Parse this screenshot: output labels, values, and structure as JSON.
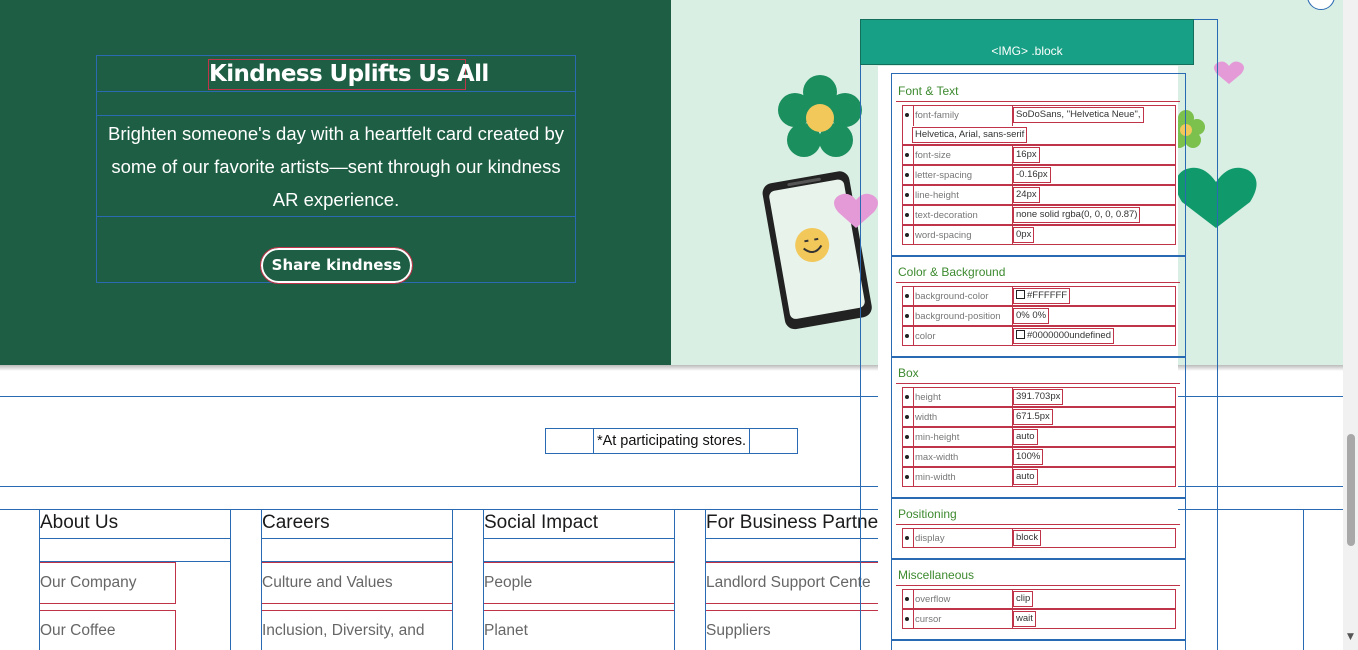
{
  "hero": {
    "title": "Kindness Uplifts Us All",
    "body": "Brighten someone's day with a heartfelt card created by some of our favorite artists—sent through our kindness AR experience.",
    "cta": "Share kindness",
    "colors": {
      "left_bg": "#1e5e44",
      "right_bg": "#d9efe3"
    }
  },
  "footnote": "*At participating stores.",
  "footer": {
    "columns": [
      {
        "heading": "About Us",
        "links": [
          "Our Company",
          "Our Coffee"
        ]
      },
      {
        "heading": "Careers",
        "links": [
          "Culture and Values",
          "Inclusion, Diversity, and"
        ]
      },
      {
        "heading": "Social Impact",
        "links": [
          "People",
          "Planet"
        ]
      },
      {
        "heading": "For Business Partne",
        "links": [
          "Landlord Support Cente",
          "Suppliers"
        ]
      }
    ]
  },
  "inspector": {
    "header": "<IMG> .block",
    "sections": [
      {
        "title": "Font & Text",
        "props": [
          {
            "name": "font-family",
            "value": "SoDoSans, \"Helvetica Neue\",",
            "value2": "Helvetica, Arial, sans-serif"
          },
          {
            "name": "font-size",
            "value": "16px"
          },
          {
            "name": "letter-spacing",
            "value": "-0.16px"
          },
          {
            "name": "line-height",
            "value": "24px"
          },
          {
            "name": "text-decoration",
            "value": "none solid rgba(0, 0, 0, 0.87)"
          },
          {
            "name": "word-spacing",
            "value": "0px"
          }
        ]
      },
      {
        "title": "Color & Background",
        "props": [
          {
            "name": "background-color",
            "value": "#FFFFFF"
          },
          {
            "name": "background-position",
            "value": "0% 0%"
          },
          {
            "name": "color",
            "value": "#0000000undefined"
          }
        ]
      },
      {
        "title": "Box",
        "props": [
          {
            "name": "height",
            "value": "391.703px"
          },
          {
            "name": "width",
            "value": "671.5px"
          },
          {
            "name": "min-height",
            "value": "auto"
          },
          {
            "name": "max-width",
            "value": "100%"
          },
          {
            "name": "min-width",
            "value": "auto"
          }
        ]
      },
      {
        "title": "Positioning",
        "props": [
          {
            "name": "display",
            "value": "block"
          }
        ]
      },
      {
        "title": "Miscellaneous",
        "props": [
          {
            "name": "overflow",
            "value": "clip"
          },
          {
            "name": "cursor",
            "value": "wait"
          }
        ]
      }
    ]
  }
}
